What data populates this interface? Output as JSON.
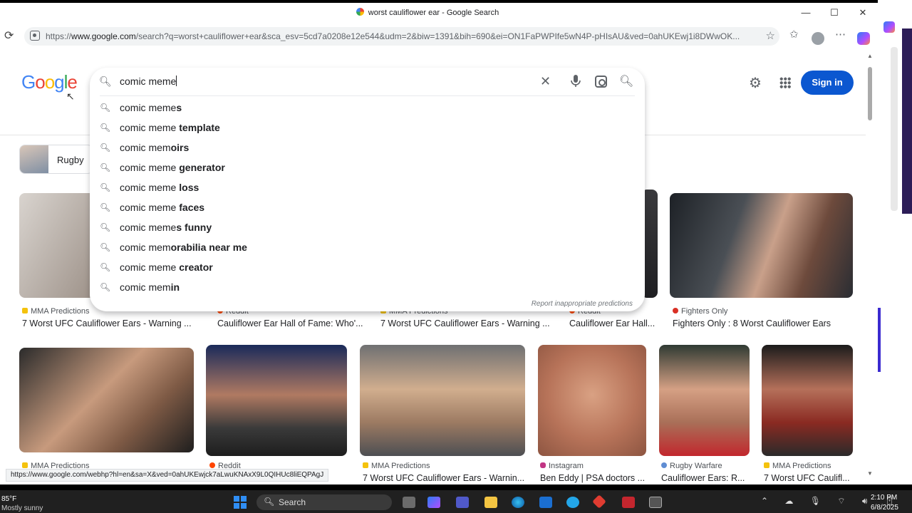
{
  "window": {
    "title": "worst cauliflower ear - Google Search",
    "minimize": "—",
    "maximize": "☐",
    "close": "✕"
  },
  "address_bar": {
    "url_scheme": "https://",
    "url_host": "www.google.com",
    "url_rest": "/search?q=worst+cauliflower+ear&sca_esv=5cd7a0208e12e544&udm=2&biw=1391&bih=690&ei=ON1FaPWPIfe5wN4P-pHIsAU&ved=0ahUKEwj1i8DWwOK..."
  },
  "google": {
    "logo_letters": [
      "G",
      "o",
      "o",
      "g",
      "l",
      "e"
    ],
    "logo_colors": [
      "#4285f4",
      "#ea4335",
      "#fbbc05",
      "#4285f4",
      "#34a853",
      "#ea4335"
    ],
    "sign_in": "Sign in",
    "accent": "#0b57d0"
  },
  "search": {
    "query": "comic meme",
    "suggestions": [
      {
        "typed": "comic meme",
        "completion": "s"
      },
      {
        "typed": "comic meme",
        "completion": " template"
      },
      {
        "typed": "comic mem",
        "completion": "oirs"
      },
      {
        "typed": "comic meme",
        "completion": " generator"
      },
      {
        "typed": "comic meme",
        "completion": " loss"
      },
      {
        "typed": "comic meme",
        "completion": " faces"
      },
      {
        "typed": "comic meme",
        "completion": "s funny"
      },
      {
        "typed": "comic mem",
        "completion": "orabilia near me"
      },
      {
        "typed": "comic meme",
        "completion": " creator"
      },
      {
        "typed": "comic mem",
        "completion": "in"
      }
    ],
    "report": "Report inappropriate predictions"
  },
  "chip": {
    "label": "Rugby"
  },
  "results_row1": [
    {
      "source": "MMA Predictions",
      "title": "7 Worst UFC Cauliflower Ears - Warning ...",
      "fav": "#f4c20d"
    },
    {
      "source": "Reddit",
      "title": "Cauliflower Ear Hall of Fame: Who'...",
      "fav": "#ff4500"
    },
    {
      "source": "MMA Predictions",
      "title": "7 Worst UFC Cauliflower Ears - Warning ...",
      "fav": "#f4c20d"
    },
    {
      "source": "Reddit",
      "title": "Cauliflower Ear Hall...",
      "fav": "#ff4500"
    },
    {
      "source": "Fighters Only",
      "title": "Fighters Only : 8 Worst Cauliflower Ears",
      "fav": "#d93025"
    }
  ],
  "results_row2": [
    {
      "source": "MMA Predictions",
      "title": "",
      "fav": "#f4c20d"
    },
    {
      "source": "Reddit",
      "title": "",
      "fav": "#ff4500"
    },
    {
      "source": "MMA Predictions",
      "title": "7 Worst UFC Cauliflower Ears - Warnin...",
      "fav": "#f4c20d"
    },
    {
      "source": "Instagram",
      "title": "Ben Eddy | PSA doctors ...",
      "fav": "#c13584"
    },
    {
      "source": "Rugby Warfare",
      "title": "Cauliflower Ears: R...",
      "fav": "#5f8dd3"
    },
    {
      "source": "MMA Predictions",
      "title": "7 Worst UFC Caulifl...",
      "fav": "#f4c20d"
    }
  ],
  "status_url": "https://www.google.com/webhp?hl=en&sa=X&ved=0ahUKEwjck7aLwuKNAxX9L0QIHUc8liEQPAgJ",
  "taskbar": {
    "weather_temp": "85°F",
    "weather_desc": "Mostly sunny",
    "search_label": "Search",
    "time": "2:10 PM",
    "date": "6/8/2025"
  }
}
